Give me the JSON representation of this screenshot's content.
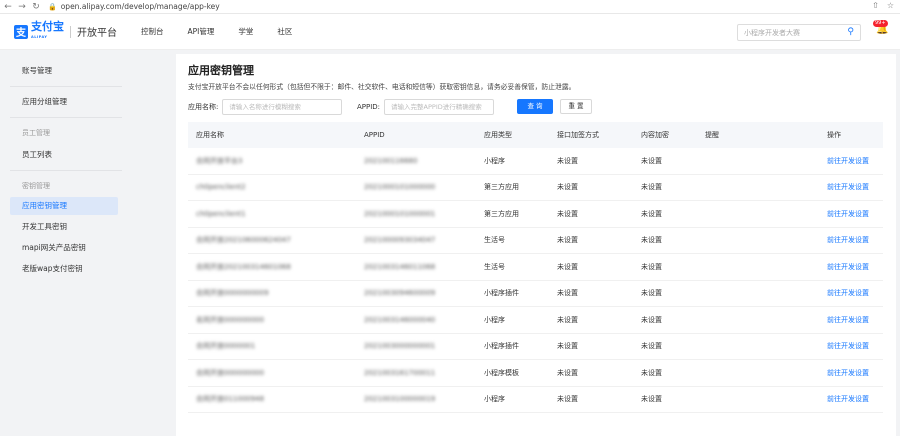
{
  "browser": {
    "url_text": "open.alipay.com/develop/manage/app-key"
  },
  "header": {
    "logo_text": "支付宝",
    "logo_sub": "ALIPAY",
    "platform": "开放平台",
    "nav": [
      "控制台",
      "API管理",
      "学堂",
      "社区"
    ],
    "search_placeholder": "小程序开发者大赛",
    "badge": "99+"
  },
  "sidebar": {
    "items": [
      {
        "label": "账号管理",
        "type": "item"
      },
      {
        "label": "应用分组管理",
        "type": "item"
      },
      {
        "label": "员工管理",
        "type": "group"
      },
      {
        "label": "员工列表",
        "type": "item"
      },
      {
        "label": "密钥管理",
        "type": "group"
      },
      {
        "label": "应用密钥管理",
        "type": "item",
        "active": true
      },
      {
        "label": "开发工具密钥",
        "type": "item"
      },
      {
        "label": "mapi网关产品密钥",
        "type": "item"
      },
      {
        "label": "老版wap支付密钥",
        "type": "item"
      }
    ]
  },
  "main": {
    "title": "应用密钥管理",
    "notice": "支付宝开放平台不会以任何形式（包括但不限于：邮件、社交软件、电话和短信等）获取密钥信息，请务必妥善保管，防止泄露。",
    "filters": {
      "app_name_label": "应用名称:",
      "app_name_placeholder": "请输入名称进行模糊搜索",
      "appid_label": "APPID:",
      "appid_placeholder": "请输入完整APPID进行精确搜索",
      "search_btn": "查 询",
      "reset_btn": "重 置"
    },
    "table": {
      "columns": [
        "应用名称",
        "APPID",
        "应用类型",
        "接口加签方式",
        "内容加密",
        "提醒",
        "操作"
      ],
      "rows": [
        {
          "name": "合同开放平台3",
          "appid": "202100116680",
          "type": "小程序",
          "sign": "未设置",
          "encrypt": "未设置",
          "remind": "",
          "action": "前往开发设置"
        },
        {
          "name": "ch0penclient2",
          "appid": "2021000101000000",
          "type": "第三方应用",
          "sign": "未设置",
          "encrypt": "未设置",
          "remind": "",
          "action": "前往开发设置"
        },
        {
          "name": "ch0penclient1",
          "appid": "2021000101000001",
          "type": "第三方应用",
          "sign": "未设置",
          "encrypt": "未设置",
          "remind": "",
          "action": "前往开发设置"
        },
        {
          "name": "合同开放202106000624047",
          "appid": "2021000093034047",
          "type": "生活号",
          "sign": "未设置",
          "encrypt": "未设置",
          "remind": "",
          "action": "前往开发设置"
        },
        {
          "name": "合同开放202100314601068",
          "appid": "2021003146011068",
          "type": "生活号",
          "sign": "未设置",
          "encrypt": "未设置",
          "remind": "",
          "action": "前往开发设置"
        },
        {
          "name": "合同开放0000000009",
          "appid": "2021003094600009",
          "type": "小程序插件",
          "sign": "未设置",
          "encrypt": "未设置",
          "remind": "",
          "action": "前往开发设置"
        },
        {
          "name": "名同开放000000000",
          "appid": "2021003146000040",
          "type": "小程序",
          "sign": "未设置",
          "encrypt": "未设置",
          "remind": "",
          "action": "前往开发设置"
        },
        {
          "name": "合同开放0000001",
          "appid": "2021003000000001",
          "type": "小程序插件",
          "sign": "未设置",
          "encrypt": "未设置",
          "remind": "",
          "action": "前往开发设置"
        },
        {
          "name": "合同开放000000000",
          "appid": "2021003161700011",
          "type": "小程序模板",
          "sign": "未设置",
          "encrypt": "未设置",
          "remind": "",
          "action": "前往开发设置"
        },
        {
          "name": "合同开放011000948",
          "appid": "2021003100000019",
          "type": "小程序",
          "sign": "未设置",
          "encrypt": "未设置",
          "remind": "",
          "action": "前往开发设置"
        }
      ]
    }
  }
}
